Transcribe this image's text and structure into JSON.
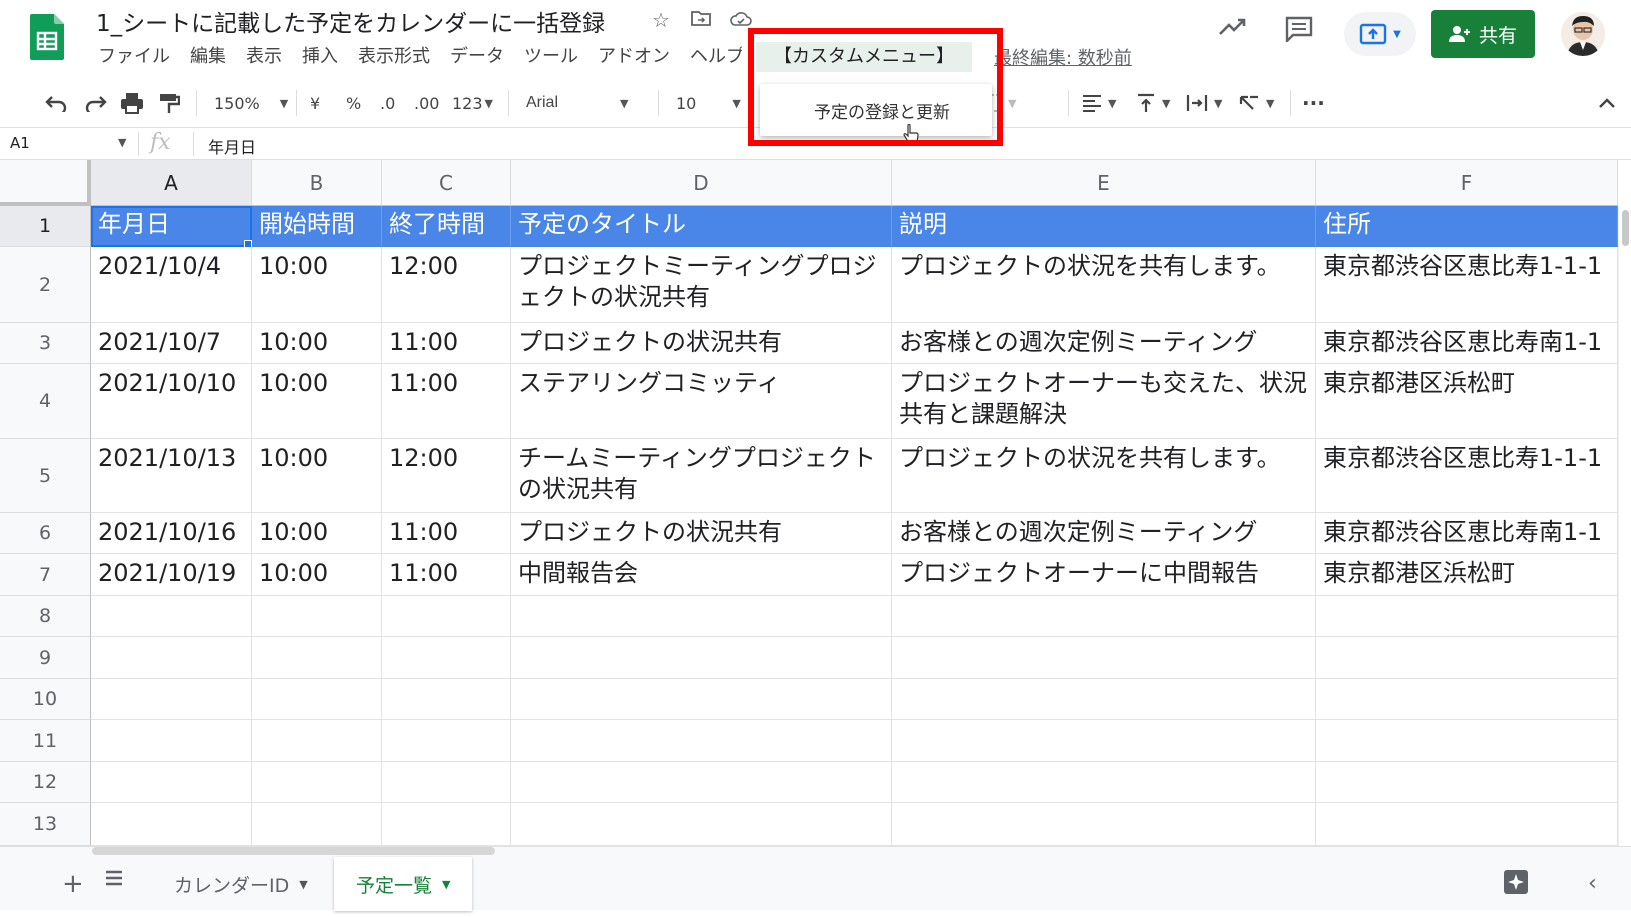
{
  "document": {
    "title": "1_シートに記載した予定をカレンダーに一括登録",
    "last_edit": "最終編集: 数秒前"
  },
  "menu": [
    "ファイル",
    "編集",
    "表示",
    "挿入",
    "表示形式",
    "データ",
    "ツール",
    "アドオン",
    "ヘルプ"
  ],
  "custom_menu": {
    "label": "【カスタムメニュー】",
    "items": [
      "予定の登録と更新"
    ]
  },
  "header": {
    "share_label": "共有"
  },
  "toolbar": {
    "zoom": "150%",
    "currency": "¥",
    "percent": "%",
    "decrease_decimal": ".0",
    "increase_decimal": ".00",
    "more_formats": "123",
    "font": "Arial",
    "font_size": "10",
    "more": "···"
  },
  "formula_bar": {
    "cell_ref": "A1",
    "fx": "fx",
    "value": "年月日"
  },
  "grid": {
    "columns": [
      "A",
      "B",
      "C",
      "D",
      "E",
      "F"
    ],
    "rows": [
      "1",
      "2",
      "3",
      "4",
      "5",
      "6",
      "7",
      "8",
      "9",
      "10",
      "11",
      "12",
      "13"
    ],
    "header_row": [
      "年月日",
      "開始時間",
      "終了時間",
      "予定のタイトル",
      "説明",
      "住所"
    ],
    "data_rows": [
      [
        "2021/10/4",
        "10:00",
        "12:00",
        "プロジェクトミーティングプロジェクトの状況共有",
        "プロジェクトの状況を共有します。",
        "東京都渋谷区恵比寿1-1-1"
      ],
      [
        "2021/10/7",
        "10:00",
        "11:00",
        "プロジェクトの状況共有",
        "お客様との週次定例ミーティング",
        "東京都渋谷区恵比寿南1-1"
      ],
      [
        "2021/10/10",
        "10:00",
        "11:00",
        "ステアリングコミッティ",
        "プロジェクトオーナーも交えた、状況共有と課題解決",
        "東京都港区浜松町"
      ],
      [
        "2021/10/13",
        "10:00",
        "12:00",
        "チームミーティングプロジェクトの状況共有",
        "プロジェクトの状況を共有します。",
        "東京都渋谷区恵比寿1-1-1"
      ],
      [
        "2021/10/16",
        "10:00",
        "11:00",
        "プロジェクトの状況共有",
        "お客様との週次定例ミーティング",
        "東京都渋谷区恵比寿南1-1"
      ],
      [
        "2021/10/19",
        "10:00",
        "11:00",
        "中間報告会",
        "プロジェクトオーナーに中間報告",
        "東京都港区浜松町"
      ]
    ]
  },
  "sheets": [
    {
      "name": "カレンダーID",
      "active": false
    },
    {
      "name": "予定一覧",
      "active": true
    }
  ],
  "colors": {
    "header_fill": "#4a86e8",
    "share_green": "#188038",
    "highlight_red": "#ff0000",
    "selection_blue": "#1a73e8"
  }
}
